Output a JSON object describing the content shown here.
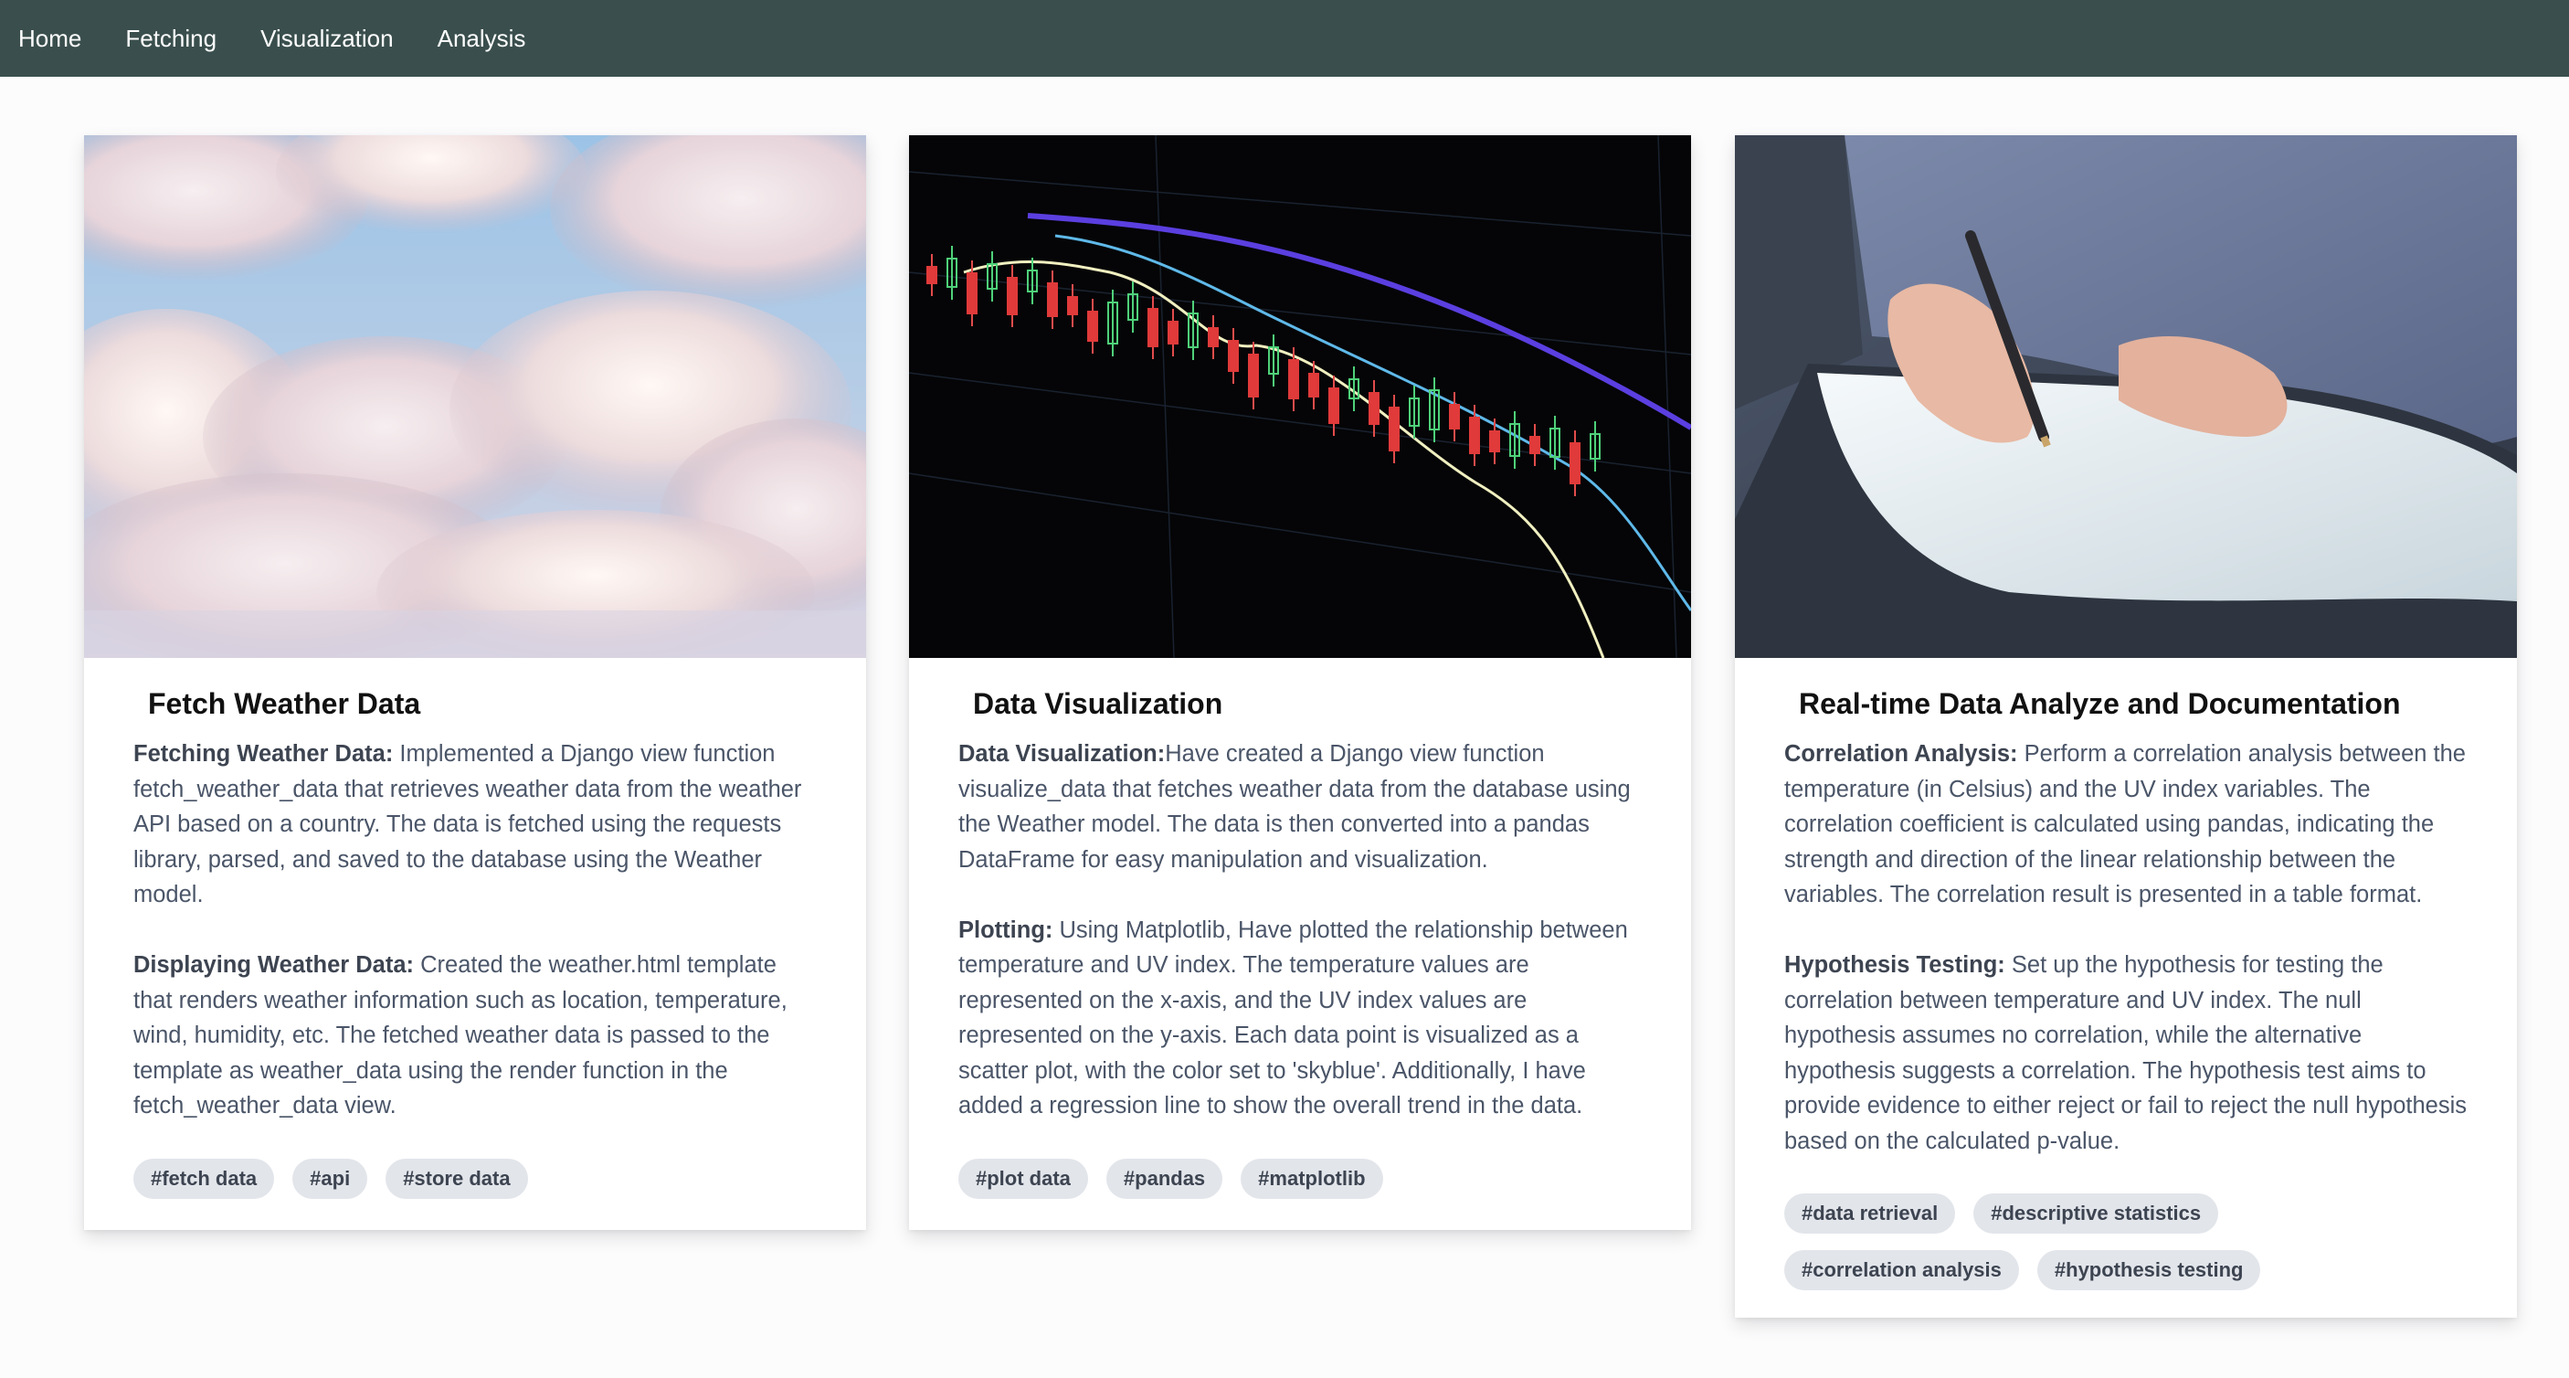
{
  "nav": {
    "items": [
      {
        "label": "Home"
      },
      {
        "label": "Fetching"
      },
      {
        "label": "Visualization"
      },
      {
        "label": "Analysis"
      }
    ]
  },
  "cards": [
    {
      "title": "Fetch Weather Data",
      "image_icon": "clouds-sky-image",
      "paragraphs": [
        {
          "heading": "Fetching Weather Data:",
          "text": " Implemented a Django view function fetch_weather_data that retrieves weather data from the weather API based on a country. The data is fetched using the requests library, parsed, and saved to the database using the Weather model."
        },
        {
          "heading": "Displaying Weather Data:",
          "text": " Created the weather.html template that renders weather information such as location, temperature, wind, humidity, etc. The fetched weather data is passed to the template as weather_data using the render function in the fetch_weather_data view."
        }
      ],
      "tags": [
        "#fetch data",
        "#api",
        "#store data"
      ]
    },
    {
      "title": "Data Visualization",
      "image_icon": "candlestick-chart-image",
      "paragraphs": [
        {
          "heading": "Data Visualization:",
          "text": "Have created a Django view function visualize_data that fetches weather data from the database using the Weather model. The data is then converted into a pandas DataFrame for easy manipulation and visualization."
        },
        {
          "heading": "Plotting:",
          "text": " Using Matplotlib, Have plotted the relationship between temperature and UV index. The temperature values are represented on the x-axis, and the UV index values are represented on the y-axis. Each data point is visualized as a scatter plot, with the color set to 'skyblue'. Additionally, I have added a regression line to show the overall trend in the data."
        }
      ],
      "tags": [
        "#plot data",
        "#pandas",
        "#matplotlib"
      ]
    },
    {
      "title": "Real-time Data Analyze and Documentation",
      "image_icon": "writing-hand-image",
      "paragraphs": [
        {
          "heading": "Correlation Analysis:",
          "text": " Perform a correlation analysis between the temperature (in Celsius) and the UV index variables. The correlation coefficient is calculated using pandas, indicating the strength and direction of the linear relationship between the variables. The correlation result is presented in a table format."
        },
        {
          "heading": "Hypothesis Testing:",
          "text": " Set up the hypothesis for testing the correlation between temperature and UV index. The null hypothesis assumes no correlation, while the alternative hypothesis suggests a correlation. The hypothesis test aims to provide evidence to either reject or fail to reject the null hypothesis based on the calculated p-value."
        }
      ],
      "tags": [
        "#data retrieval",
        "#descriptive statistics",
        "#correlation analysis",
        "#hypothesis testing"
      ]
    }
  ],
  "colors": {
    "navbar": "#3a4f4d",
    "tag_bg": "#e2e5ea",
    "page_bg": "#fcfcfd"
  }
}
